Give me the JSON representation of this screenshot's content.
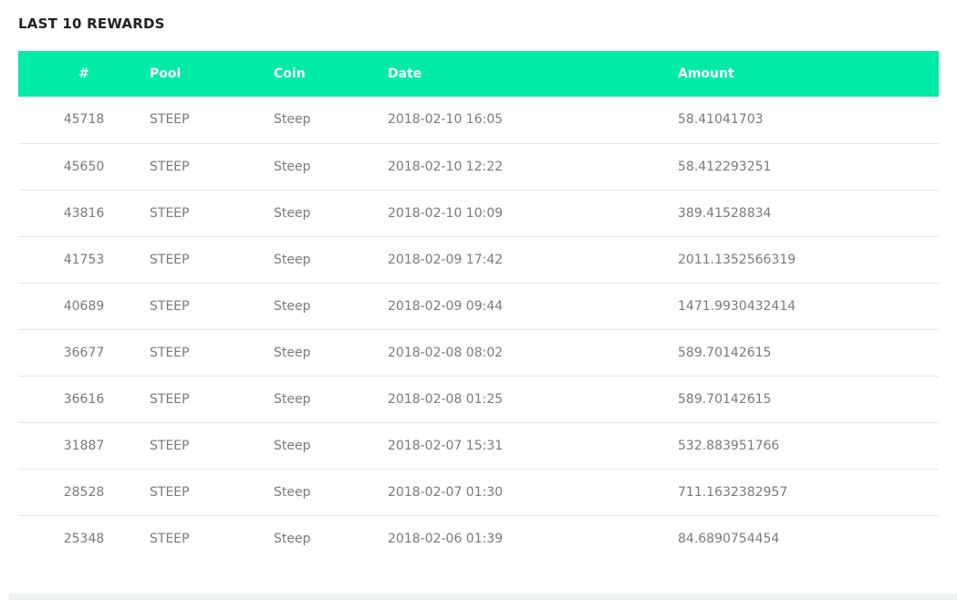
{
  "section": {
    "title": "LAST 10 REWARDS"
  },
  "table": {
    "headers": {
      "id": "#",
      "pool": "Pool",
      "coin": "Coin",
      "date": "Date",
      "amount": "Amount"
    },
    "rows": [
      {
        "id": "45718",
        "pool": "STEEP",
        "coin": "Steep",
        "date": "2018-02-10 16:05",
        "amount": "58.41041703"
      },
      {
        "id": "45650",
        "pool": "STEEP",
        "coin": "Steep",
        "date": "2018-02-10 12:22",
        "amount": "58.412293251"
      },
      {
        "id": "43816",
        "pool": "STEEP",
        "coin": "Steep",
        "date": "2018-02-10 10:09",
        "amount": "389.41528834"
      },
      {
        "id": "41753",
        "pool": "STEEP",
        "coin": "Steep",
        "date": "2018-02-09 17:42",
        "amount": "2011.1352566319"
      },
      {
        "id": "40689",
        "pool": "STEEP",
        "coin": "Steep",
        "date": "2018-02-09 09:44",
        "amount": "1471.9930432414"
      },
      {
        "id": "36677",
        "pool": "STEEP",
        "coin": "Steep",
        "date": "2018-02-08 08:02",
        "amount": "589.70142615"
      },
      {
        "id": "36616",
        "pool": "STEEP",
        "coin": "Steep",
        "date": "2018-02-08 01:25",
        "amount": "589.70142615"
      },
      {
        "id": "31887",
        "pool": "STEEP",
        "coin": "Steep",
        "date": "2018-02-07 15:31",
        "amount": "532.883951766"
      },
      {
        "id": "28528",
        "pool": "STEEP",
        "coin": "Steep",
        "date": "2018-02-07 01:30",
        "amount": "711.1632382957"
      },
      {
        "id": "25348",
        "pool": "STEEP",
        "coin": "Steep",
        "date": "2018-02-06 01:39",
        "amount": "84.6890754454"
      }
    ]
  },
  "colors": {
    "header_bg": "#00eba5",
    "header_text": "#ffffff",
    "cell_text": "#7a7a7a",
    "title_text": "#222222",
    "row_divider": "#e6e6e6"
  }
}
